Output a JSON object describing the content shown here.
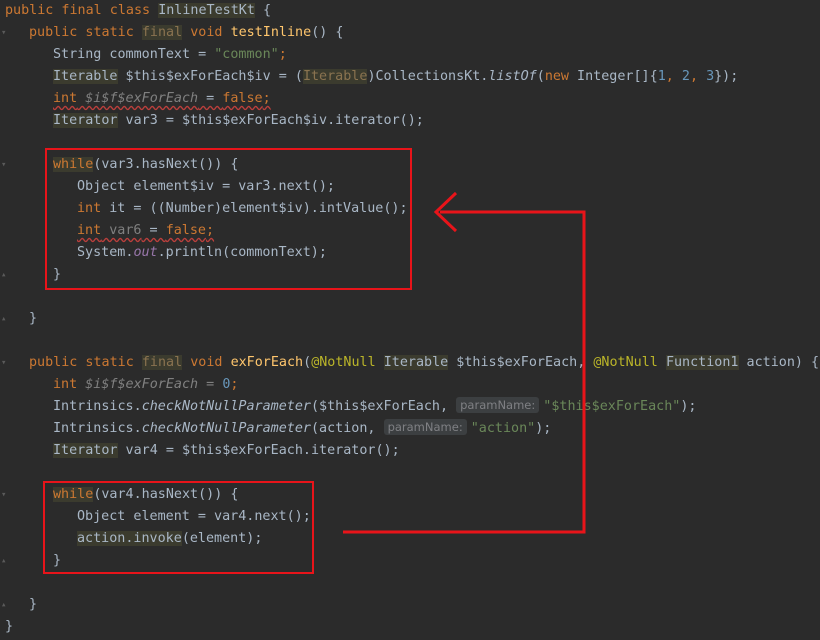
{
  "code": {
    "l1": {
      "kw1": "public final class",
      "cls": "InlineTestKt",
      "brace": "{"
    },
    "l2": {
      "kw1": "public static",
      "kw_final": "final",
      "kw2": "void",
      "fn": "testInline",
      "rest": "() {"
    },
    "l3": {
      "type": "String commonText = ",
      "str": "\"common\"",
      "end": ";"
    },
    "l4": {
      "type": "Iterable",
      "a": " $this$exForEach$iv = (",
      "cast": "Iterable",
      "b": ")CollectionsKt.",
      "m": "listOf",
      "c": "(",
      "kw": "new",
      "d": " Integer[]{",
      "n1": "1",
      "sep1": ", ",
      "n2": "2",
      "sep2": ", ",
      "n3": "3",
      "e": "});"
    },
    "l5": {
      "kw": "int",
      "var": " $i$f$exForEach",
      "eq": " = ",
      "val": "false",
      "end": ";"
    },
    "l6": {
      "type": "Iterator",
      "rest": " var3 = $this$exForEach$iv.iterator();"
    },
    "l7": {
      "kw": "while",
      "rest": "(var3.hasNext()) {"
    },
    "l8": {
      "text": "Object element$iv = var3.next();"
    },
    "l9": {
      "kw": "int",
      "rest": " it = ((Number)element$iv).intValue();"
    },
    "l10": {
      "kw": "int",
      "var": " var6",
      "eq": " = ",
      "val": "false",
      "end": ";"
    },
    "l11": {
      "a": "System.",
      "fld": "out",
      "b": ".println(commonText);"
    },
    "l12": {
      "text": "}"
    },
    "l13": {
      "text": "}"
    },
    "l14": {
      "kw1": "public static",
      "kw_final": "final",
      "kw2": "void",
      "fn": "exForEach",
      "p1": "(",
      "ann1": "@NotNull",
      "t1": "Iterable",
      "p2": " $this$exForEach, ",
      "ann2": "@NotNull",
      "t2": "Function1",
      "p3": " action) {"
    },
    "l15": {
      "kw": "int",
      "rest": " $i$f$exForEach = ",
      "num": "0",
      "end": ";"
    },
    "l16": {
      "a": "Intrinsics.",
      "m": "checkNotNullParameter",
      "b": "($this$exForEach, ",
      "hint": "paramName:",
      "str": "\"$this$exForEach\"",
      "end": ");"
    },
    "l17": {
      "a": "Intrinsics.",
      "m": "checkNotNullParameter",
      "b": "(action, ",
      "hint": "paramName:",
      "str": "\"action\"",
      "end": ");"
    },
    "l18": {
      "type": "Iterator",
      "rest": " var4 = $this$exForEach.iterator();"
    },
    "l19": {
      "kw": "while",
      "rest": "(var4.hasNext()) {"
    },
    "l20": {
      "text": "Object element = var4.next();"
    },
    "l21": {
      "hl": "action.invoke",
      "rest": "(element);"
    },
    "l22": {
      "text": "}"
    },
    "l23": {
      "text": "}"
    },
    "l24": {
      "text": "}"
    }
  },
  "colors": {
    "annotation": "#e8141a",
    "keyword": "#cc7832",
    "string": "#6a8759",
    "number": "#6897bb"
  }
}
